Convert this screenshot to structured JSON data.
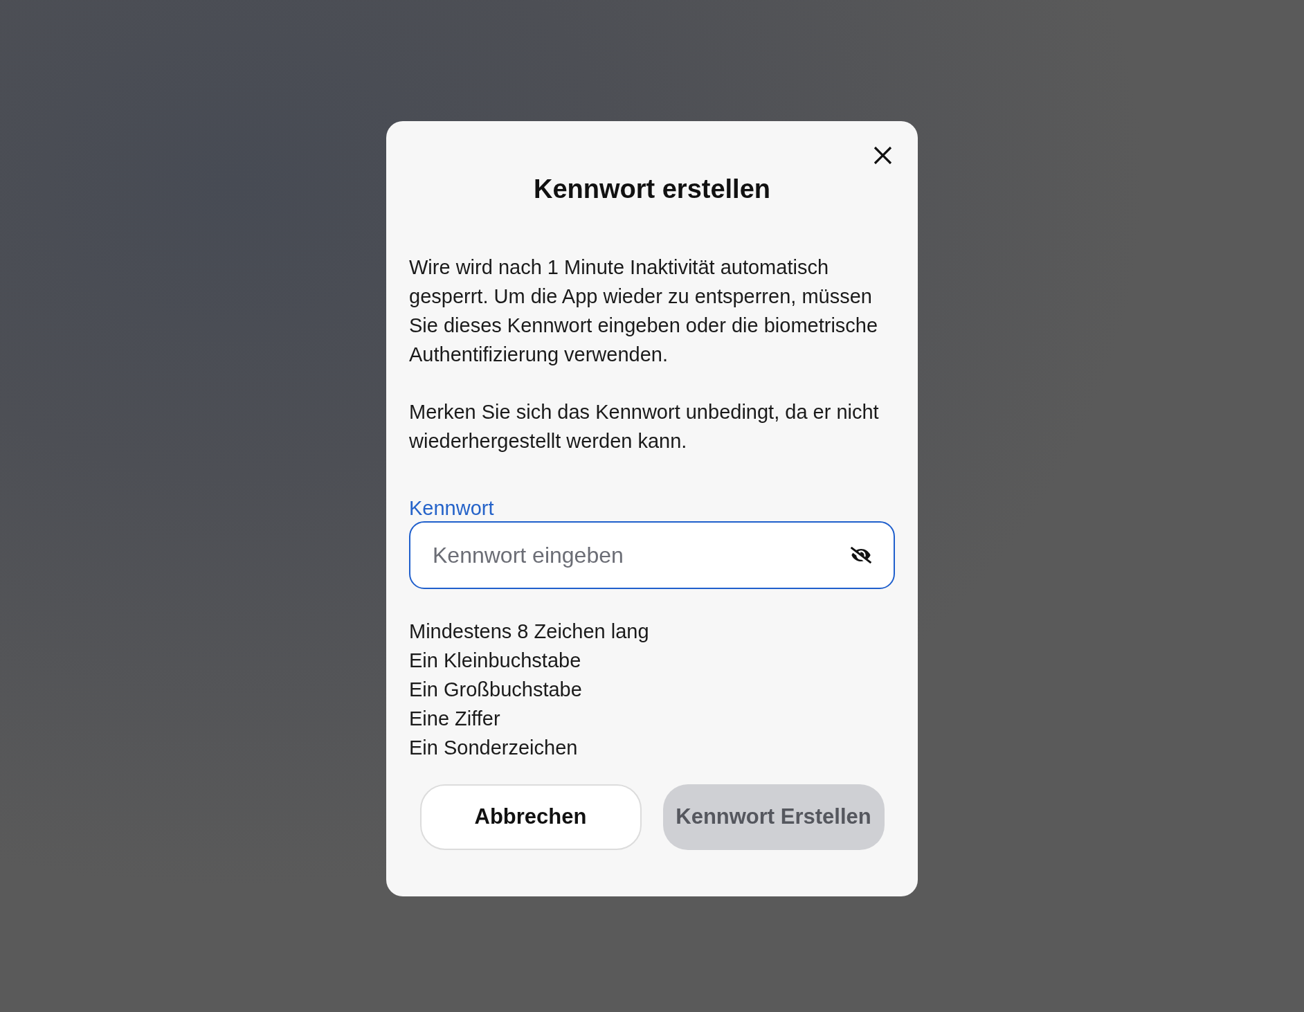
{
  "dialog": {
    "title": "Kennwort erstellen",
    "paragraphs": [
      "Wire wird nach 1 Minute Inaktivität automatisch gesperrt. Um die App wieder zu entsperren, müssen Sie dieses Kennwort eingeben oder die biometrische Authentifizierung verwenden.",
      "Merken Sie sich das Kennwort unbedingt, da er nicht wiederhergestellt werden kann."
    ],
    "password_field": {
      "label": "Kennwort",
      "placeholder": "Kennwort eingeben",
      "focused": true,
      "password_visible": false
    },
    "requirements": [
      "Mindestens 8 Zeichen lang",
      "Ein Kleinbuchstabe",
      "Ein Großbuchstabe",
      "Eine Ziffer",
      "Ein Sonderzeichen"
    ],
    "buttons": [
      {
        "label": "Abbrechen",
        "kind": "secondary",
        "disabled": false
      },
      {
        "label": "Kennwort Erstellen",
        "kind": "primary",
        "disabled": true
      }
    ]
  }
}
